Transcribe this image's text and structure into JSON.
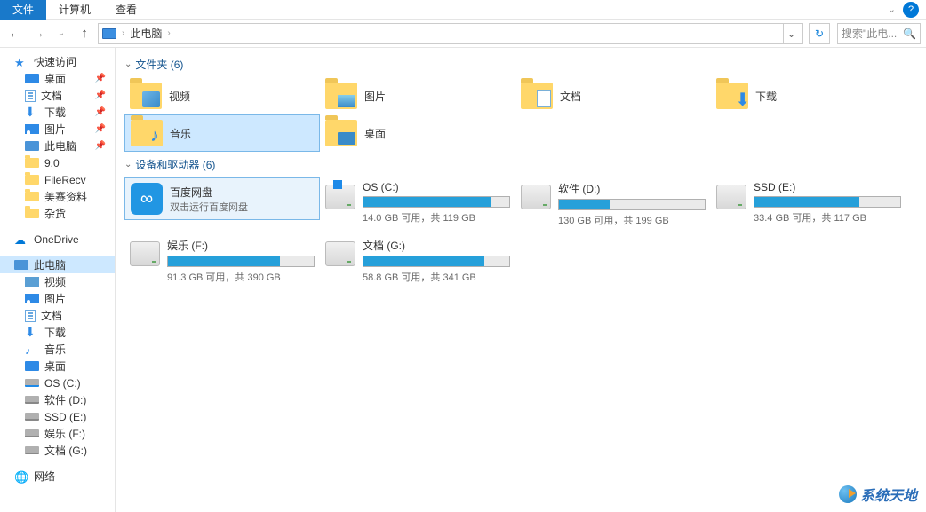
{
  "menu": {
    "file": "文件",
    "computer": "计算机",
    "view": "查看"
  },
  "nav": {
    "location": "此电脑",
    "search_placeholder": "搜索\"此电...",
    "back": "←",
    "fwd": "→",
    "up": "↑"
  },
  "sidebar": {
    "quick_access": "快速访问",
    "pinned": [
      {
        "label": "桌面",
        "icon": "desktop"
      },
      {
        "label": "文档",
        "icon": "doc"
      },
      {
        "label": "下载",
        "icon": "dl"
      },
      {
        "label": "图片",
        "icon": "pic"
      },
      {
        "label": "此电脑",
        "icon": "pc"
      }
    ],
    "recent": [
      {
        "label": "9.0"
      },
      {
        "label": "FileRecv"
      },
      {
        "label": "美赛资料"
      },
      {
        "label": "杂货"
      }
    ],
    "onedrive": "OneDrive",
    "this_pc": "此电脑",
    "pc_children": [
      {
        "label": "视频",
        "icon": "video"
      },
      {
        "label": "图片",
        "icon": "pic"
      },
      {
        "label": "文档",
        "icon": "doc"
      },
      {
        "label": "下载",
        "icon": "dl"
      },
      {
        "label": "音乐",
        "icon": "music"
      },
      {
        "label": "桌面",
        "icon": "desktop"
      },
      {
        "label": "OS (C:)",
        "icon": "drive-os"
      },
      {
        "label": "软件 (D:)",
        "icon": "drive"
      },
      {
        "label": "SSD (E:)",
        "icon": "drive"
      },
      {
        "label": "娱乐 (F:)",
        "icon": "drive"
      },
      {
        "label": "文档 (G:)",
        "icon": "drive"
      }
    ],
    "network": "网络"
  },
  "main": {
    "folders_header": "文件夹 (6)",
    "folders": [
      {
        "label": "视频",
        "overlay": "video"
      },
      {
        "label": "图片",
        "overlay": "pic"
      },
      {
        "label": "文档",
        "overlay": "doc"
      },
      {
        "label": "下载",
        "overlay": "dl"
      },
      {
        "label": "音乐",
        "overlay": "music",
        "selected": true
      },
      {
        "label": "桌面",
        "overlay": "desktop"
      }
    ],
    "devices_header": "设备和驱动器 (6)",
    "baidu": {
      "name": "百度网盘",
      "sub": "双击运行百度网盘"
    },
    "drives": [
      {
        "name": "OS (C:)",
        "free": "14.0 GB 可用，共 119 GB",
        "pct": 88,
        "os": true
      },
      {
        "name": "软件 (D:)",
        "free": "130 GB 可用，共 199 GB",
        "pct": 35
      },
      {
        "name": "SSD (E:)",
        "free": "33.4 GB 可用，共 117 GB",
        "pct": 72
      },
      {
        "name": "娱乐 (F:)",
        "free": "91.3 GB 可用，共 390 GB",
        "pct": 77
      },
      {
        "name": "文档 (G:)",
        "free": "58.8 GB 可用，共 341 GB",
        "pct": 83
      }
    ]
  },
  "watermark": "系统天地"
}
